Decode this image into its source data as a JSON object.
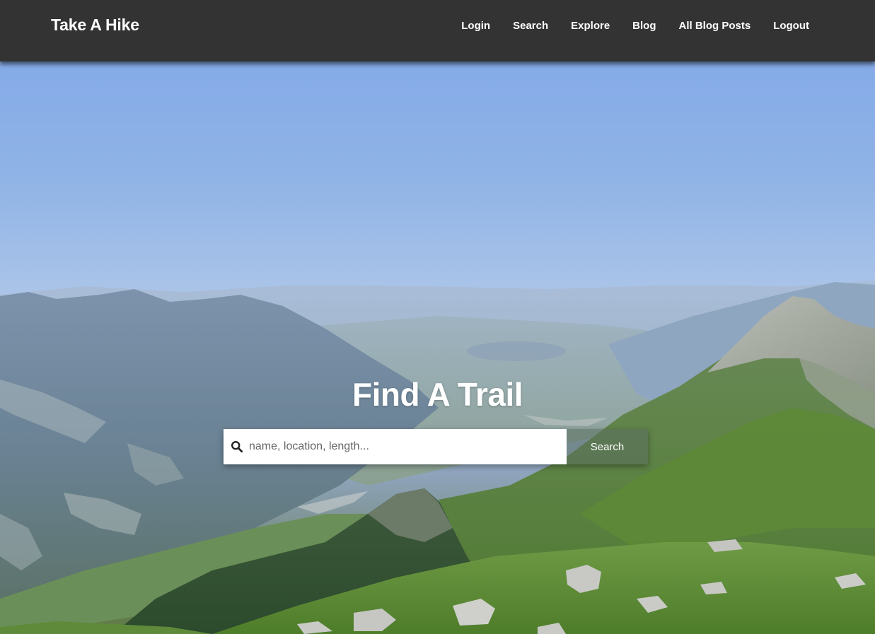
{
  "navbar": {
    "brand": "Take A Hike",
    "links": [
      {
        "label": "Login"
      },
      {
        "label": "Search"
      },
      {
        "label": "Explore"
      },
      {
        "label": "Blog"
      },
      {
        "label": "All Blog Posts"
      },
      {
        "label": "Logout"
      }
    ],
    "background_color": "#333333"
  },
  "hero": {
    "title": "Find A Trail",
    "background": "mountain-landscape-photo",
    "search": {
      "icon": "search-icon",
      "placeholder": "name, location, length...",
      "value": "",
      "button_label": "Search"
    }
  }
}
